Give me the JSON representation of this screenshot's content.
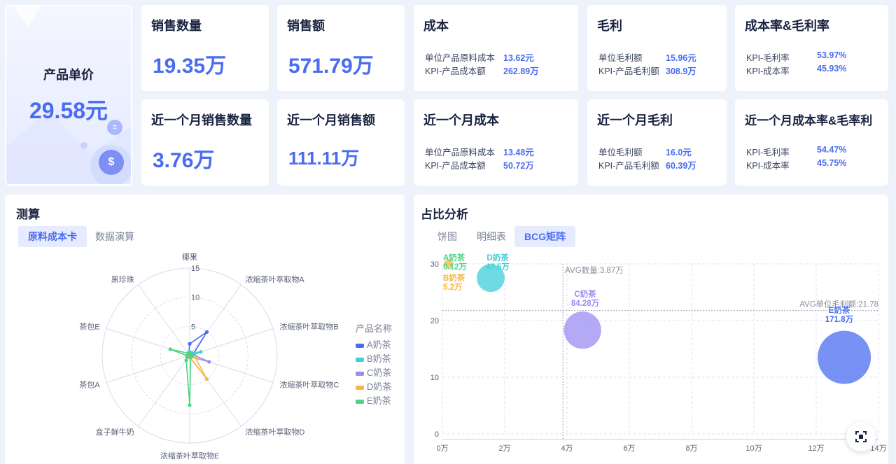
{
  "hero": {
    "title": "产品单价",
    "value": "29.58元"
  },
  "cards": {
    "sales_qty": {
      "title": "销售数量",
      "value": "19.35万"
    },
    "sales_amt": {
      "title": "销售额",
      "value": "571.79万"
    },
    "cost": {
      "title": "成本",
      "rows": [
        {
          "k": "单位产品原料成本",
          "v": "13.62元"
        },
        {
          "k": "KPI-产品成本额",
          "v": "262.89万"
        }
      ]
    },
    "gross": {
      "title": "毛利",
      "rows": [
        {
          "k": "单位毛利额",
          "v": "15.96元"
        },
        {
          "k": "KPI-产品毛利额",
          "v": "308.9万"
        }
      ]
    },
    "rate": {
      "title": "成本率&毛利率",
      "rows": [
        {
          "k": "KPI-毛利率",
          "v": "53.97%"
        },
        {
          "k": "KPI-成本率",
          "v": "45.93%"
        }
      ]
    },
    "m_sales_qty": {
      "title": "近一个月销售数量",
      "value": "3.76万"
    },
    "m_sales_amt": {
      "title": "近一个月销售额",
      "value": "111.11万"
    },
    "m_cost": {
      "title": "近一个月成本",
      "rows": [
        {
          "k": "单位产品原料成本",
          "v": "13.48元"
        },
        {
          "k": "KPI-产品成本额",
          "v": "50.72万"
        }
      ]
    },
    "m_gross": {
      "title": "近一个月毛利",
      "rows": [
        {
          "k": "单位毛利额",
          "v": "16.0元"
        },
        {
          "k": "KPI-产品毛利额",
          "v": "60.39万"
        }
      ]
    },
    "m_rate": {
      "title": "近一个月成本率&毛率利",
      "rows": [
        {
          "k": "KPI-毛利率",
          "v": "54.47%"
        },
        {
          "k": "KPI-成本率",
          "v": "45.75%"
        }
      ]
    }
  },
  "left_panel": {
    "title": "测算",
    "tabs": [
      "原料成本卡",
      "数据演算"
    ],
    "active_tab": 0
  },
  "right_panel": {
    "title": "占比分析",
    "tabs": [
      "饼图",
      "明细表",
      "BCG矩阵"
    ],
    "active_tab": 2
  },
  "colors": {
    "A": "#4a6cf0",
    "B": "#3ecfd8",
    "C": "#9b8cf2",
    "D": "#f3b845",
    "E": "#4bd585",
    "accent": "#4a6cf0"
  },
  "chart_data": [
    {
      "type": "radar",
      "legend_title": "产品名称",
      "legend_placement": "right",
      "indicators": [
        "椰果",
        "浓缩茶叶萃取物A",
        "浓缩茶叶萃取物B",
        "浓缩茶叶萃取物C",
        "浓缩茶叶萃取物D",
        "浓缩茶叶萃取物E",
        "盒子鲜牛奶",
        "茶包A",
        "茶包E",
        "黑珍珠"
      ],
      "max": 15,
      "ticks": [
        "5",
        "10",
        "15"
      ],
      "series": [
        {
          "name": "A奶茶",
          "values": [
            2.0,
            5.0,
            0.6,
            0.3,
            0.3,
            0.3,
            0.3,
            0.3,
            0.3,
            0.3
          ]
        },
        {
          "name": "B奶茶",
          "values": [
            0.6,
            0.6,
            2.0,
            0.3,
            0.3,
            0.3,
            0.3,
            0.3,
            0.3,
            0.3
          ]
        },
        {
          "name": "C奶茶",
          "values": [
            0.3,
            0.3,
            0.6,
            3.5,
            0.3,
            0.3,
            0.3,
            0.5,
            0.3,
            0.3
          ]
        },
        {
          "name": "D奶茶",
          "values": [
            0.3,
            0.3,
            0.3,
            1.0,
            5.0,
            0.3,
            0.3,
            0.3,
            0.3,
            0.3
          ]
        },
        {
          "name": "E奶茶",
          "values": [
            0.3,
            0.3,
            0.3,
            0.3,
            0.3,
            8.5,
            1.0,
            0.3,
            3.5,
            0.5
          ]
        }
      ]
    },
    {
      "type": "scatter",
      "subtype": "bubble",
      "xlim": [
        0,
        14
      ],
      "ylim": [
        0,
        30
      ],
      "x_ticks": [
        "0万",
        "2万",
        "4万",
        "6万",
        "8万",
        "10万",
        "12万",
        "14万"
      ],
      "y_ticks": [
        "0",
        "10",
        "20",
        "30"
      ],
      "grid": true,
      "ref_lines": [
        {
          "axis": "x",
          "value": 3.87,
          "label": "AVG数量:3.87万"
        },
        {
          "axis": "y",
          "value": 21.78,
          "label": "AVG单位毛利额:21.78"
        }
      ],
      "points": [
        {
          "name": "A奶茶",
          "label": "0.12万",
          "x": 0.12,
          "y": 31,
          "size": 0.12,
          "color_key": "E"
        },
        {
          "name": "B奶茶",
          "label": "5.2万",
          "x": 0.2,
          "y": 30,
          "size": 5.2,
          "color_key": "D"
        },
        {
          "name": "D奶茶",
          "label": "47.5万",
          "x": 1.55,
          "y": 27.5,
          "size": 47.5,
          "color_key": "B"
        },
        {
          "name": "C奶茶",
          "label": "84.28万",
          "x": 4.5,
          "y": 18.3,
          "size": 84.28,
          "color_key": "C"
        },
        {
          "name": "E奶茶",
          "label": "171.8万",
          "x": 12.9,
          "y": 13.5,
          "size": 171.8,
          "color_key": "A"
        }
      ]
    }
  ]
}
